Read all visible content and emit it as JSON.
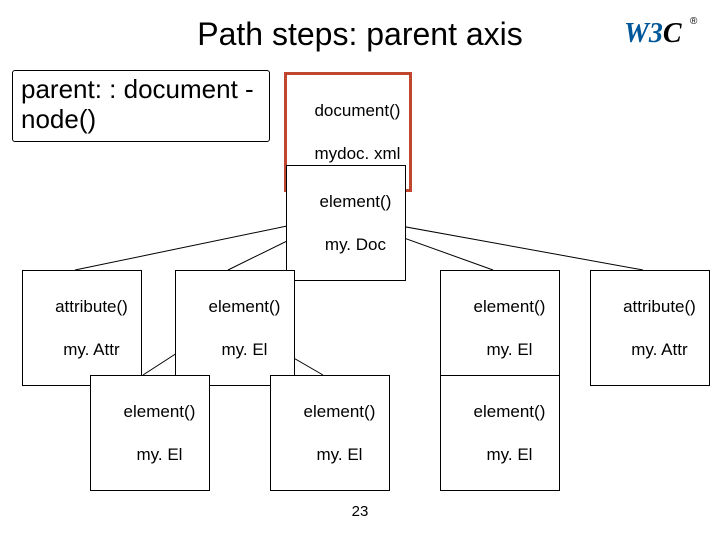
{
  "title": "Path steps: parent axis",
  "path_label": "parent: : document\n-node()",
  "page_number": "23",
  "nodes": {
    "doc": {
      "line1": "document()",
      "line2": "mydoc. xml"
    },
    "root": {
      "line1": "element()",
      "line2": "my. Doc"
    },
    "attr_left": {
      "line1": "attribute()",
      "line2": "my. Attr"
    },
    "el_l": {
      "line1": "element()",
      "line2": "my. El"
    },
    "el_r": {
      "line1": "element()",
      "line2": "my. El"
    },
    "attr_right": {
      "line1": "attribute()",
      "line2": "my. Attr"
    },
    "leaf1": {
      "line1": "element()",
      "line2": "my. El"
    },
    "leaf2": {
      "line1": "element()",
      "line2": "my. El"
    },
    "leaf3": {
      "line1": "element()",
      "line2": "my. El"
    }
  },
  "logo_text": "W3C",
  "logo_reg": "®"
}
